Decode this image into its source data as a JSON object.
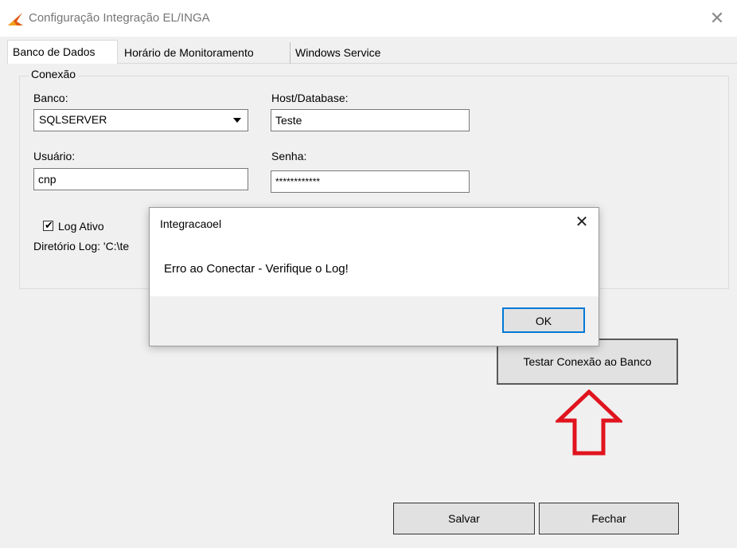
{
  "window": {
    "title": "Configuração Integração EL/INGA",
    "close_glyph": "✕",
    "logo_icon": "app-logo-icon",
    "logo_color": "#e05a14"
  },
  "tabs": [
    {
      "label": "Banco de Dados",
      "active": true
    },
    {
      "label": "Horário de Monitoramento",
      "active": false
    },
    {
      "label": "Windows Service",
      "active": false
    }
  ],
  "conexao": {
    "group_title": "Conexão",
    "banco_label": "Banco:",
    "banco_value": "SQLSERVER",
    "host_label": "Host/Database:",
    "host_value": "Teste",
    "usuario_label": "Usuário:",
    "usuario_value": "cnp",
    "senha_label": "Senha:",
    "senha_value": "************",
    "log_ativo_label": "Log Ativo",
    "log_ativo_checked": true,
    "diretorio_log": "Diretório Log: 'C:\\te"
  },
  "buttons": {
    "testar": "Testar Conexão ao Banco",
    "salvar": "Salvar",
    "fechar": "Fechar"
  },
  "dialog": {
    "title": "Integracaoel",
    "message": "Erro ao Conectar - Verifique o Log!",
    "ok_label": "OK",
    "close_glyph": "✕"
  },
  "annotation": {
    "arrow_color": "#e0141e",
    "arrow_icon": "up-arrow-outline-icon"
  }
}
